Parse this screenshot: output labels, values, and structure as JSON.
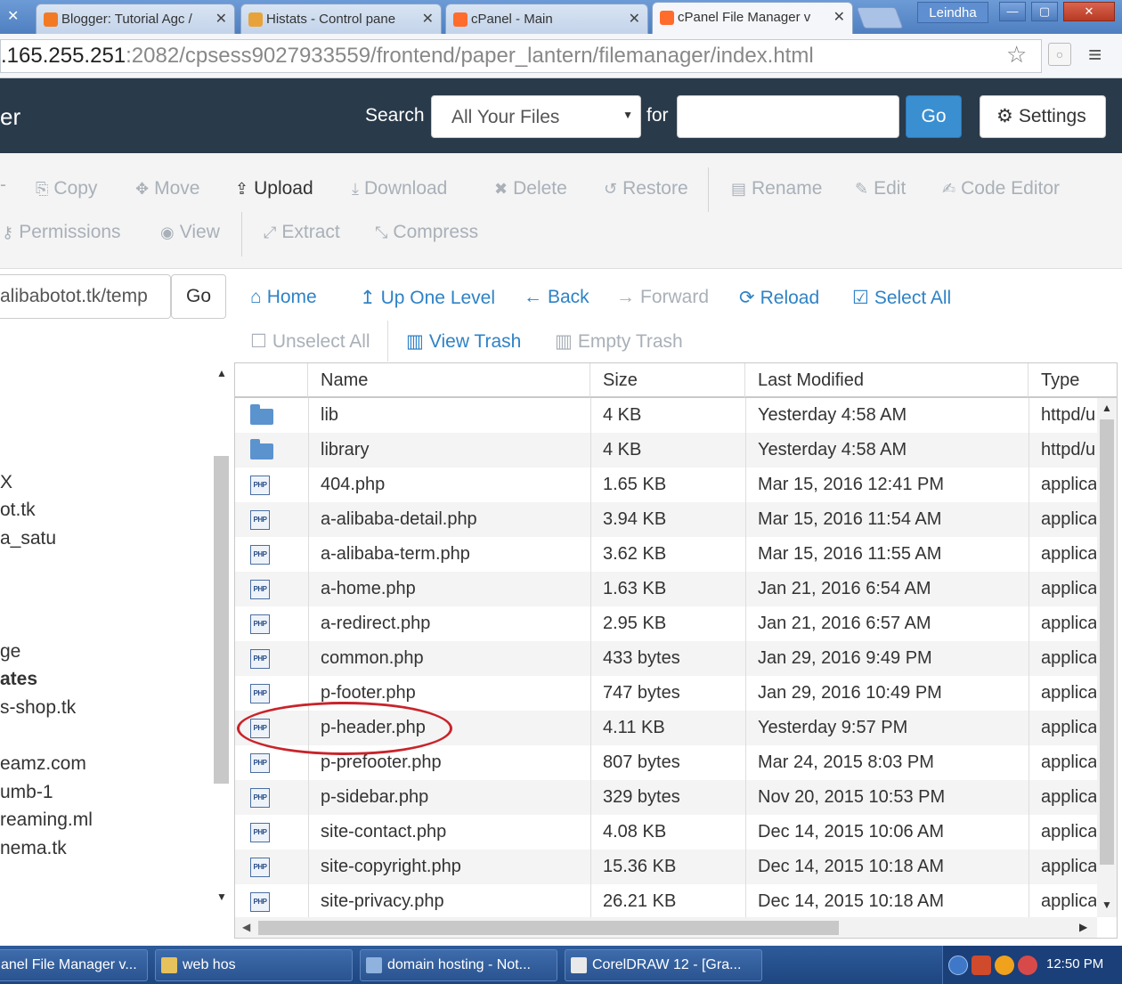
{
  "browser": {
    "tabs": [
      {
        "title": "Blogger: Tutorial Agc /",
        "favicon_color": "#f27a25"
      },
      {
        "title": "Histats - Control pane",
        "favicon_color": "#e8a23a"
      },
      {
        "title": "cPanel - Main",
        "favicon_color": "#ff6c2c"
      },
      {
        "title": "cPanel File Manager v",
        "favicon_color": "#ff6c2c",
        "active": true
      }
    ],
    "profile_name": "Leindha",
    "window_buttons": [
      "—",
      "▢",
      "✕"
    ],
    "url_host": ".165.255.251",
    "url_rest": ":2082/cpsess9027933559/frontend/paper_lantern/filemanager/index.html"
  },
  "header": {
    "title": "er",
    "search_label": "Search",
    "search_scope": "All Your Files",
    "for_label": "for",
    "search_value": "",
    "go_label": "Go",
    "settings_label": "Settings",
    "bg_color": "#293a4a",
    "accent": "#3a8fd1"
  },
  "toolbar": {
    "row1": [
      {
        "label": "Copy",
        "icon": "copy-icon",
        "glyph": "⎘",
        "enabled": false
      },
      {
        "label": "Move",
        "icon": "move-icon",
        "glyph": "✥",
        "enabled": false
      },
      {
        "label": "Upload",
        "icon": "upload-icon",
        "glyph": "⇪",
        "enabled": true
      },
      {
        "label": "Download",
        "icon": "download-icon",
        "glyph": "⤓",
        "enabled": false
      },
      {
        "label": "Delete",
        "icon": "delete-icon",
        "glyph": "✖",
        "enabled": false
      },
      {
        "label": "Restore",
        "icon": "restore-icon",
        "glyph": "↺",
        "enabled": false
      },
      {
        "label": "Rename",
        "icon": "rename-icon",
        "glyph": "▤",
        "enabled": false
      },
      {
        "label": "Edit",
        "icon": "edit-icon",
        "glyph": "✎",
        "enabled": false
      },
      {
        "label": "Code Editor",
        "icon": "code-editor-icon",
        "glyph": "✍",
        "enabled": false
      }
    ],
    "row2": [
      {
        "label": "Permissions",
        "icon": "key-icon",
        "glyph": "⚷",
        "enabled": false
      },
      {
        "label": "View",
        "icon": "eye-icon",
        "glyph": "◉",
        "enabled": false
      },
      {
        "label": "Extract",
        "icon": "expand-icon",
        "glyph": "⤢",
        "enabled": false
      },
      {
        "label": "Compress",
        "icon": "compress-icon",
        "glyph": "⤡",
        "enabled": false
      }
    ]
  },
  "path": {
    "value": "alibabotot.tk/temp",
    "go_label": "Go"
  },
  "nav": {
    "row1": [
      {
        "label": "Home",
        "icon": "home-icon",
        "glyph": "⌂",
        "enabled": true
      },
      {
        "label": "Up One Level",
        "icon": "level-up-icon",
        "glyph": "↥",
        "enabled": true
      },
      {
        "label": "Back",
        "icon": "arrow-left-icon",
        "glyph": "🡐",
        "enabled": true
      },
      {
        "label": "Forward",
        "icon": "arrow-right-icon",
        "glyph": "🡒",
        "enabled": false
      },
      {
        "label": "Reload",
        "icon": "reload-icon",
        "glyph": "⟳",
        "enabled": true
      },
      {
        "label": "Select All",
        "icon": "check-square-icon",
        "glyph": "☑",
        "enabled": true
      }
    ],
    "row2": [
      {
        "label": "Unselect All",
        "icon": "square-icon",
        "glyph": "☐",
        "enabled": false
      },
      {
        "label": "View Trash",
        "icon": "trash-icon",
        "glyph": "🗑",
        "enabled": true
      },
      {
        "label": "Empty Trash",
        "icon": "trash-icon",
        "glyph": "🗑",
        "enabled": false
      }
    ]
  },
  "tree": {
    "items": [
      "X",
      "ot.tk",
      "a_satu",
      "ge",
      "ates",
      "s-shop.tk",
      "eamz.com",
      "umb-1",
      "reaming.ml",
      "nema.tk"
    ],
    "bold_index": 4
  },
  "table": {
    "columns": [
      "Name",
      "Size",
      "Last Modified",
      "Type"
    ],
    "rows": [
      {
        "icon": "folder",
        "name": "lib",
        "size": "4 KB",
        "modified": "Yesterday 4:58 AM",
        "type": "httpd/u"
      },
      {
        "icon": "folder",
        "name": "library",
        "size": "4 KB",
        "modified": "Yesterday 4:58 AM",
        "type": "httpd/u"
      },
      {
        "icon": "php",
        "name": "404.php",
        "size": "1.65 KB",
        "modified": "Mar 15, 2016 12:41 PM",
        "type": "applica"
      },
      {
        "icon": "php",
        "name": "a-alibaba-detail.php",
        "size": "3.94 KB",
        "modified": "Mar 15, 2016 11:54 AM",
        "type": "applica"
      },
      {
        "icon": "php",
        "name": "a-alibaba-term.php",
        "size": "3.62 KB",
        "modified": "Mar 15, 2016 11:55 AM",
        "type": "applica"
      },
      {
        "icon": "php",
        "name": "a-home.php",
        "size": "1.63 KB",
        "modified": "Jan 21, 2016 6:54 AM",
        "type": "applica"
      },
      {
        "icon": "php",
        "name": "a-redirect.php",
        "size": "2.95 KB",
        "modified": "Jan 21, 2016 6:57 AM",
        "type": "applica"
      },
      {
        "icon": "php",
        "name": "common.php",
        "size": "433 bytes",
        "modified": "Jan 29, 2016 9:49 PM",
        "type": "applica"
      },
      {
        "icon": "php",
        "name": "p-footer.php",
        "size": "747 bytes",
        "modified": "Jan 29, 2016 10:49 PM",
        "type": "applica"
      },
      {
        "icon": "php",
        "name": "p-header.php",
        "size": "4.11 KB",
        "modified": "Yesterday 9:57 PM",
        "type": "applica"
      },
      {
        "icon": "php",
        "name": "p-prefooter.php",
        "size": "807 bytes",
        "modified": "Mar 24, 2015 8:03 PM",
        "type": "applica"
      },
      {
        "icon": "php",
        "name": "p-sidebar.php",
        "size": "329 bytes",
        "modified": "Nov 20, 2015 10:53 PM",
        "type": "applica"
      },
      {
        "icon": "php",
        "name": "site-contact.php",
        "size": "4.08 KB",
        "modified": "Dec 14, 2015 10:06 AM",
        "type": "applica"
      },
      {
        "icon": "php",
        "name": "site-copyright.php",
        "size": "15.36 KB",
        "modified": "Dec 14, 2015 10:18 AM",
        "type": "applica"
      },
      {
        "icon": "php",
        "name": "site-privacy.php",
        "size": "26.21 KB",
        "modified": "Dec 14, 2015 10:18 AM",
        "type": "applica"
      }
    ],
    "php_icon_text": "PHP"
  },
  "taskbar": {
    "tasks": [
      {
        "label": "anel File Manager v..."
      },
      {
        "label": "web hos"
      },
      {
        "label": "domain hosting - Not..."
      },
      {
        "label": "CorelDRAW 12 - [Gra..."
      }
    ],
    "clock": "12:50 PM"
  }
}
